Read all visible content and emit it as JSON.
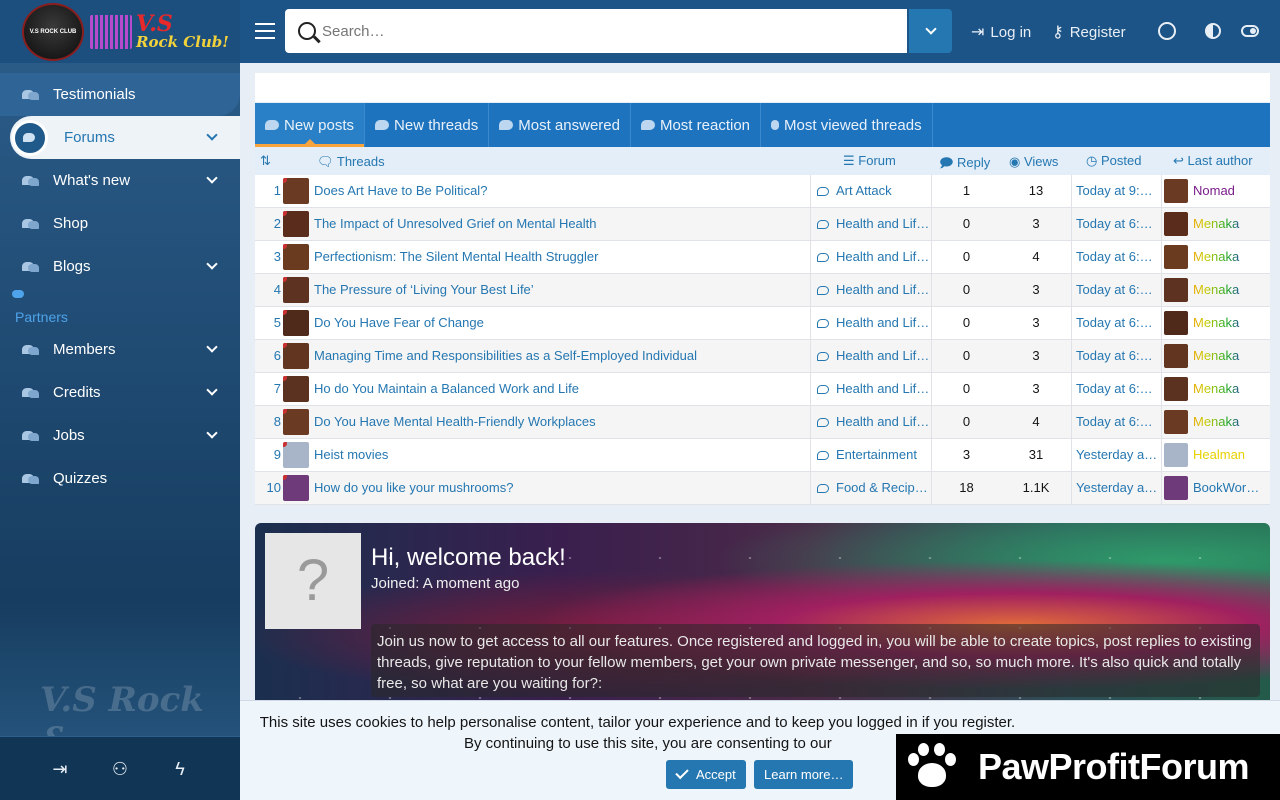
{
  "brand": {
    "logo_alt": "V.S Rock Club!",
    "logo_vs": "V.S",
    "logo_club": "Rock Club!",
    "badge": "V.S ROCK CLUB"
  },
  "sidebar": {
    "items": [
      {
        "label": "Testimonials",
        "has_chevron": false
      },
      {
        "label": "Forums",
        "has_chevron": true,
        "active": true
      },
      {
        "label": "What's new",
        "has_chevron": true
      },
      {
        "label": "Shop",
        "has_chevron": false
      },
      {
        "label": "Blogs",
        "has_chevron": true
      },
      {
        "label": "Partners",
        "has_chevron": false
      },
      {
        "label": "Members",
        "has_chevron": true
      },
      {
        "label": "Credits",
        "has_chevron": true
      },
      {
        "label": "Jobs",
        "has_chevron": true
      },
      {
        "label": "Quizzes",
        "has_chevron": false
      }
    ],
    "watermark": "V.S Rock &",
    "footer_icons": [
      "login-icon",
      "register-icon",
      "bolt-icon"
    ]
  },
  "header": {
    "search_placeholder": "Search…",
    "login_label": "Log in",
    "register_label": "Register"
  },
  "tabs": [
    {
      "label": "New posts",
      "active": true
    },
    {
      "label": "New threads"
    },
    {
      "label": "Most answered"
    },
    {
      "label": "Most reaction"
    },
    {
      "label": "Most viewed threads"
    }
  ],
  "table": {
    "headers": {
      "threads": "Threads",
      "forum": "Forum",
      "reply": "Reply",
      "views": "Views",
      "posted": "Posted",
      "author": "Last author"
    },
    "rows": [
      {
        "num": "1",
        "title": "Does Art Have to Be Political?",
        "forum": "Art Attack",
        "reply": "1",
        "views": "13",
        "posted": "Today at 9:…",
        "author": "Nomad",
        "author_style": "purple"
      },
      {
        "num": "2",
        "title": "The Impact of Unresolved Grief on Mental Health",
        "forum": "Health and Lif…",
        "reply": "0",
        "views": "3",
        "posted": "Today at 6:…",
        "author": "Menaka",
        "author_style": "rainbow"
      },
      {
        "num": "3",
        "title": "Perfectionism: The Silent Mental Health Struggler",
        "forum": "Health and Lif…",
        "reply": "0",
        "views": "4",
        "posted": "Today at 6:…",
        "author": "Menaka",
        "author_style": "rainbow"
      },
      {
        "num": "4",
        "title": "The Pressure of ‘Living Your Best Life’",
        "forum": "Health and Lif…",
        "reply": "0",
        "views": "3",
        "posted": "Today at 6:…",
        "author": "Menaka",
        "author_style": "rainbow"
      },
      {
        "num": "5",
        "title": "Do You Have Fear of Change",
        "forum": "Health and Lif…",
        "reply": "0",
        "views": "3",
        "posted": "Today at 6:…",
        "author": "Menaka",
        "author_style": "rainbow"
      },
      {
        "num": "6",
        "title": "Managing Time and Responsibilities as a Self-Employed Individual",
        "forum": "Health and Lif…",
        "reply": "0",
        "views": "3",
        "posted": "Today at 6:…",
        "author": "Menaka",
        "author_style": "rainbow"
      },
      {
        "num": "7",
        "title": "Ho do You Maintain a Balanced Work and Life",
        "forum": "Health and Lif…",
        "reply": "0",
        "views": "3",
        "posted": "Today at 6:…",
        "author": "Menaka",
        "author_style": "rainbow"
      },
      {
        "num": "8",
        "title": "Do You Have Mental Health-Friendly Workplaces",
        "forum": "Health and Lif…",
        "reply": "0",
        "views": "4",
        "posted": "Today at 6:…",
        "author": "Menaka",
        "author_style": "rainbow"
      },
      {
        "num": "9",
        "title": "Heist movies",
        "forum": "Entertainment",
        "reply": "3",
        "views": "31",
        "posted": "Yesterday a…",
        "author": "Healman",
        "author_style": "yellow"
      },
      {
        "num": "10",
        "title": "How do you like your mushrooms?",
        "forum": "Food & Recip…",
        "reply": "18",
        "views": "1.1K",
        "posted": "Yesterday a…",
        "author": "BookWor…",
        "author_style": "blue"
      }
    ]
  },
  "welcome": {
    "avatar_glyph": "?",
    "title": "Hi, welcome back!",
    "joined": "Joined: A moment ago",
    "message": "Join us now to get access to all our features. Once registered and logged in, you will be able to create topics, post replies to existing threads, give reputation to your fellow members, get your own private messenger, and so, so much more. It's also quick and totally free, so what are you waiting for?:"
  },
  "cookie": {
    "line1": "This site uses cookies to help personalise content, tailor your experience and to keep you logged in if you register.",
    "line2": "By continuing to use this site, you are consenting to our",
    "accept": "Accept",
    "learn_more": "Learn more…"
  },
  "watermark_brand": "PawProfitForum",
  "colors": {
    "accent": "#2577b1",
    "header": "#1c5487",
    "tabs": "#1e73be",
    "active_tab_underline": "#f7a43c"
  }
}
